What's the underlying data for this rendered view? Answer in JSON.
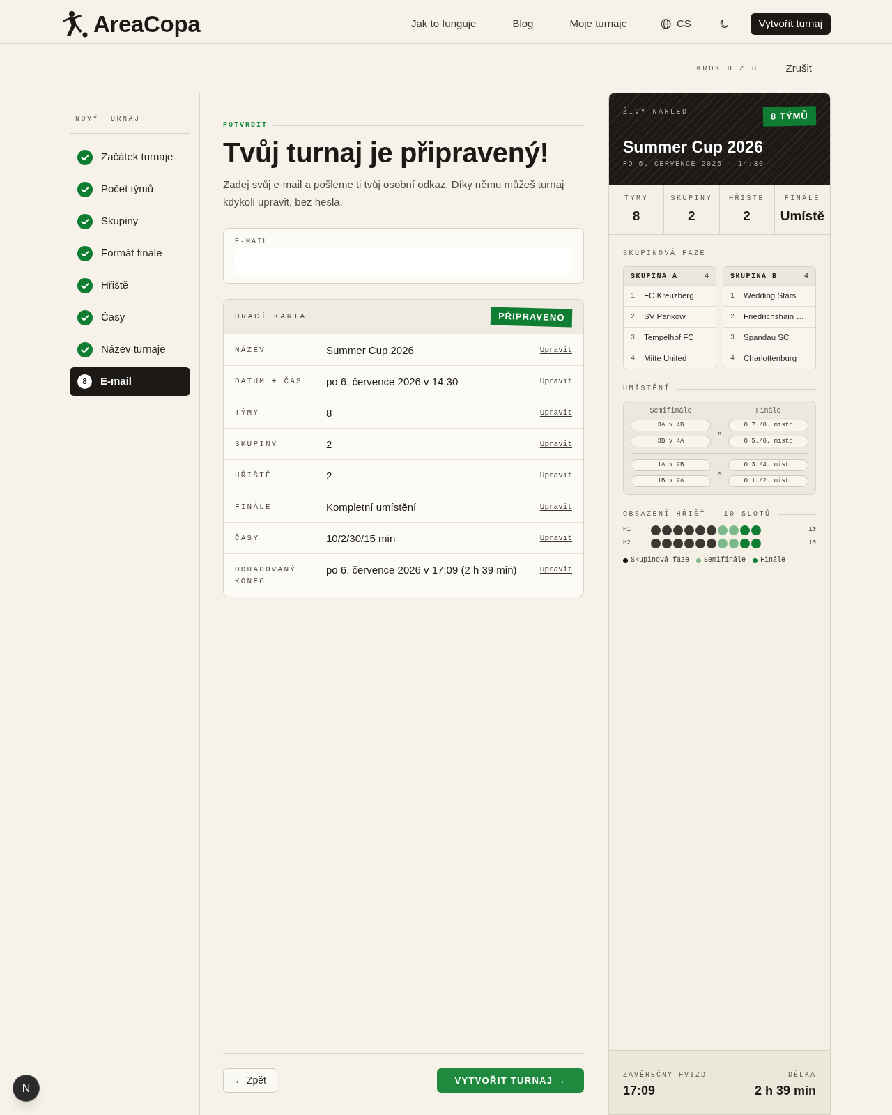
{
  "header": {
    "brand": "AreaCopa",
    "nav": [
      {
        "label": "Jak to funguje"
      },
      {
        "label": "Blog"
      },
      {
        "label": "Moje turnaje"
      }
    ],
    "language": "CS",
    "cta": "Vytvořit turnaj"
  },
  "progress": {
    "step": "KROK 8 Z 8",
    "cancel": "Zrušit"
  },
  "sidebar": {
    "title": "NOVÝ TURNAJ",
    "steps": [
      {
        "label": "Začátek turnaje",
        "done": true,
        "selected": false
      },
      {
        "label": "Počet týmů",
        "done": true,
        "selected": false
      },
      {
        "label": "Skupiny",
        "done": true,
        "selected": false
      },
      {
        "label": "Formát finále",
        "done": true,
        "selected": false
      },
      {
        "label": "Hřiště",
        "done": true,
        "selected": false
      },
      {
        "label": "Časy",
        "done": true,
        "selected": false
      },
      {
        "label": "Název turnaje",
        "done": true,
        "selected": false
      },
      {
        "label": "E-mail",
        "number": "8",
        "done": false,
        "selected": true
      }
    ]
  },
  "main": {
    "eyebrow": "POTVRDIT",
    "title": "Tvůj turnaj je připravený!",
    "intro": "Zadej svůj e-mail a pošleme ti tvůj osobní odkaz. Díky němu můžeš turnaj kdykoli upravit, bez hesla.",
    "email_field": {
      "label": "E-MAIL"
    },
    "summary": {
      "title": "HRACÍ KARTA",
      "badge": "PŘIPRAVENO",
      "rows": [
        {
          "label": "NÁZEV",
          "value": "Summer Cup 2026",
          "action": "Upravit"
        },
        {
          "label": "DATUM + ČAS",
          "value": "po 6. července 2026 v 14:30",
          "action": "Upravit"
        },
        {
          "label": "TÝMY",
          "value": "8",
          "action": "Upravit"
        },
        {
          "label": "SKUPINY",
          "value": "2",
          "action": "Upravit"
        },
        {
          "label": "HŘIŠTĚ",
          "value": "2",
          "action": "Upravit"
        },
        {
          "label": "FINÁLE",
          "value": "Kompletní umístění",
          "action": "Upravit"
        },
        {
          "label": "ČASY",
          "value": "10/2/30/15 min",
          "action": "Upravit"
        },
        {
          "label": "ODHADOVANÝ KONEC",
          "value": "po 6. července 2026 v 17:09 (2 h 39 min)",
          "action": "Upravit"
        }
      ]
    },
    "back": "← Zpět",
    "submit": "VYTVOŘIT TURNAJ →"
  },
  "preview": {
    "eyebrow": "ŽIVÝ NÁHLED",
    "badge": "8 TÝMŮ",
    "title": "Summer Cup 2026",
    "subtitle": "PO 6. ČERVENCE 2026 · 14:30",
    "stats": [
      {
        "label": "TÝMY",
        "value": "8"
      },
      {
        "label": "SKUPINY",
        "value": "2"
      },
      {
        "label": "HŘIŠTĚ",
        "value": "2"
      },
      {
        "label": "FINÁLE",
        "value": "Umístě"
      }
    ],
    "groups_title": "SKUPINOVÁ FÁZE",
    "groups": [
      {
        "name": "SKUPINA A",
        "count": "4",
        "teams": [
          {
            "rank": "1",
            "name": "FC Kreuzberg"
          },
          {
            "rank": "2",
            "name": "SV Pankow"
          },
          {
            "rank": "3",
            "name": "Tempelhof FC"
          },
          {
            "rank": "4",
            "name": "Mitte United"
          }
        ]
      },
      {
        "name": "SKUPINA B",
        "count": "4",
        "teams": [
          {
            "rank": "1",
            "name": "Wedding Stars"
          },
          {
            "rank": "2",
            "name": "Friedrichshain …"
          },
          {
            "rank": "3",
            "name": "Spandau SC"
          },
          {
            "rank": "4",
            "name": "Charlottenburg"
          }
        ]
      }
    ],
    "placement_title": "UMÍSTĚNÍ",
    "bracket": {
      "headings": [
        "Semifinále",
        "Finále"
      ],
      "blocks": [
        {
          "semifinals": [
            "3A v 4B",
            "3B v 4A"
          ],
          "separator": "×",
          "finals": [
            "O 7./8. misto",
            "O 5./6. misto"
          ]
        },
        {
          "semifinals": [
            "1A v 2B",
            "1B v 2A"
          ],
          "separator": "×",
          "finals": [
            "O 3./4. misto",
            "O 1./2. misto"
          ]
        }
      ]
    },
    "occupancy": {
      "title": "OBSAZENÍ HŘIŠŤ · 10 SLOTŮ",
      "rows": [
        {
          "label": "H1",
          "slots": [
            {
              "color": "#3b3733"
            },
            {
              "color": "#3b3733"
            },
            {
              "color": "#3b3733"
            },
            {
              "color": "#3b3733"
            },
            {
              "color": "#3b3733"
            },
            {
              "color": "#3b3733"
            },
            {
              "color": "#7bb98b"
            },
            {
              "color": "#7bb98b"
            },
            {
              "color": "#0f7d32"
            },
            {
              "color": "#0f7d32"
            }
          ],
          "count": "10"
        },
        {
          "label": "H2",
          "slots": [
            {
              "color": "#3b3733"
            },
            {
              "color": "#3b3733"
            },
            {
              "color": "#3b3733"
            },
            {
              "color": "#3b3733"
            },
            {
              "color": "#3b3733"
            },
            {
              "color": "#3b3733"
            },
            {
              "color": "#7bb98b"
            },
            {
              "color": "#7bb98b"
            },
            {
              "color": "#0f7d32"
            },
            {
              "color": "#0f7d32"
            }
          ],
          "count": "10"
        }
      ],
      "legend": [
        {
          "label": "Skupinová fáze",
          "color": "#141210"
        },
        {
          "label": "Semifinále",
          "color": "#7bb98b"
        },
        {
          "label": "Finále",
          "color": "#0f7d32"
        }
      ]
    },
    "footer": {
      "end_label": "ZÁVĚREČNÝ HVIZD",
      "end_value": "17:09",
      "duration_label": "DÉLKA",
      "duration_value": "2 h 39 min"
    }
  },
  "dev_badge": "N"
}
